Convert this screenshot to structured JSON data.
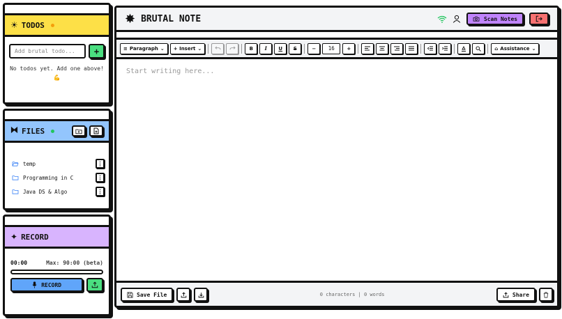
{
  "todos": {
    "title": "TODOS",
    "input_placeholder": "Add brutal todo...",
    "add_label": "+",
    "empty_message": "No todos yet. Add one above!",
    "empty_emoji": "💪",
    "dot_color": "#f59e0b"
  },
  "files": {
    "title": "FILES",
    "dot_color": "#22c55e",
    "items": [
      {
        "name": "temp",
        "icon": "folder-open-icon"
      },
      {
        "name": "Programming in C",
        "icon": "folder-icon"
      },
      {
        "name": "Java DS & Algo",
        "icon": "folder-icon"
      }
    ],
    "kebab_label": "⋮"
  },
  "record": {
    "title": "RECORD",
    "time": "00:00",
    "max": "Max: 90:00 (beta)",
    "button_label": "RECORD",
    "progress": 0
  },
  "header": {
    "brand": "BRUTAL NOTE",
    "scan_label": "Scan Notes"
  },
  "toolbar": {
    "paragraph": "Paragraph",
    "insert": "+ Insert",
    "bold": "B",
    "italic": "I",
    "underline": "U",
    "strike": "S",
    "minus": "−",
    "font_size": "16",
    "plus": "+",
    "assistance": "Assistance"
  },
  "editor": {
    "placeholder": "Start writing here..."
  },
  "footer": {
    "save_label": "Save File",
    "stats": "0 characters | 0 words",
    "share_label": "Share"
  },
  "colors": {
    "todos": "#fde047",
    "files": "#93c5fd",
    "record": "#d8b4fe",
    "scan": "#c084fc",
    "logout": "#f87171",
    "green": "#4ade80",
    "blue": "#60a5fa"
  }
}
